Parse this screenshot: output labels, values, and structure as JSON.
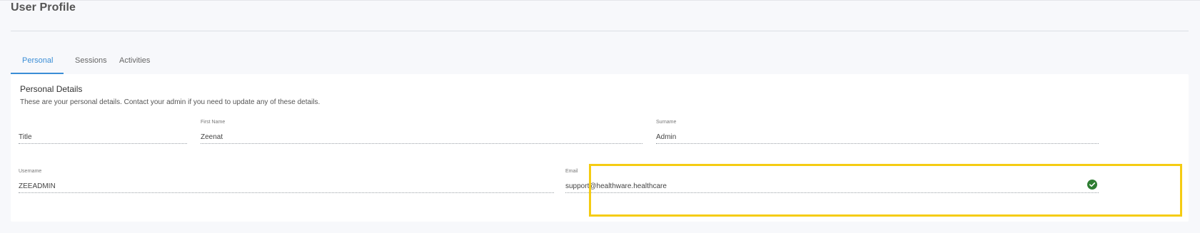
{
  "page": {
    "title": "User Profile"
  },
  "tabs": [
    {
      "label": "Personal",
      "active": true
    },
    {
      "label": "Sessions",
      "active": false
    },
    {
      "label": "Activities",
      "active": false
    }
  ],
  "personal_details": {
    "title": "Personal Details",
    "subtitle": "These are your personal details. Contact your admin if you need to update any of these details.",
    "fields": {
      "title": {
        "label": "",
        "value": "Title"
      },
      "first_name": {
        "label": "First Name",
        "value": "Zeenat"
      },
      "surname": {
        "label": "Surname",
        "value": "Admin"
      },
      "username": {
        "label": "Username",
        "value": "ZEEADMIN"
      },
      "email": {
        "label": "Email",
        "value": "support@healthware.healthcare",
        "verified_icon": "check-circle-icon"
      }
    }
  },
  "colors": {
    "accent": "#3b8ed6",
    "verified": "#2e7d32",
    "highlight": "#f5cc12"
  }
}
